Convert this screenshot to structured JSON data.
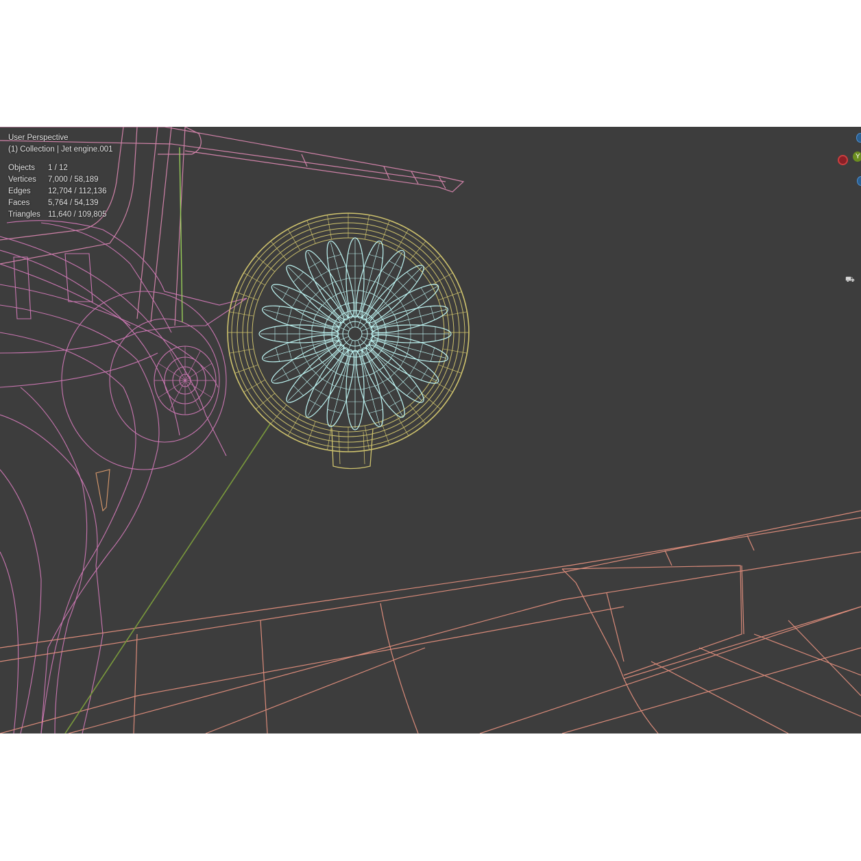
{
  "viewport": {
    "view_name": "User Perspective",
    "collection_label": "(1) Collection | Jet engine.001",
    "stats": [
      {
        "label": "Objects",
        "value": "1 / 12"
      },
      {
        "label": "Vertices",
        "value": "7,000 / 58,189"
      },
      {
        "label": "Edges",
        "value": "12,704 / 112,136"
      },
      {
        "label": "Faces",
        "value": "5,764 / 54,139"
      },
      {
        "label": "Triangles",
        "value": "11,640 / 109,805"
      }
    ]
  },
  "gizmo": {
    "y_label": "Y",
    "x_color": "#c94040",
    "y_color": "#6b8d1f",
    "z_color": "#4d90d4"
  },
  "colors": {
    "background": "#3d3d3d",
    "wire_pink": "#d27ab8",
    "wire_salmon": "#e4907e",
    "wire_yellow": "#cfc36d",
    "wire_cyan": "#bff6f4",
    "wire_green": "#7a9a3c"
  },
  "icons": {
    "view_icon": "camera-view-icon"
  }
}
